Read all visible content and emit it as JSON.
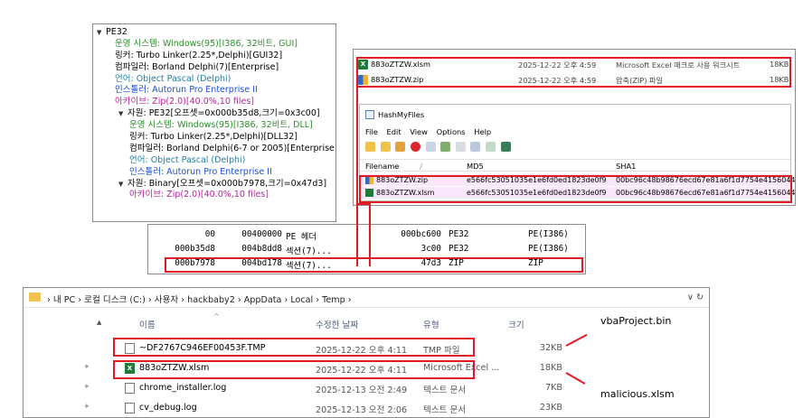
{
  "pe_tree": {
    "rows": [
      {
        "text": "PE32",
        "arrow": "▼",
        "color": "black",
        "level": "top"
      },
      {
        "text": "운영 시스템: Windows(95)[I386, 32비트, GUI]",
        "color": "green",
        "level": "indent1"
      },
      {
        "text": "링커: Turbo Linker(2.25*,Delphi)[GUI32]",
        "color": "black",
        "level": "indent1"
      },
      {
        "text": "컴파일러: Borland Delphi(7)[Enterprise]",
        "color": "black",
        "level": "indent1"
      },
      {
        "text": "언어: Object Pascal (Delphi)",
        "color": "teal",
        "level": "indent1"
      },
      {
        "text": "인스톨러: Autorun Pro Enterprise II",
        "color": "blue",
        "level": "indent1"
      },
      {
        "text": "아카이브: Zip(2.0)[40.0%,10 files]",
        "color": "mag",
        "level": "indent1"
      },
      {
        "text": "자원: PE32[오프셋=0x000b35d8,크기=0x3c00]",
        "arrow": "▼",
        "color": "black",
        "level": "sub"
      },
      {
        "text": "운영 시스템: Windows(95)[I386, 32비트, DLL]",
        "color": "green",
        "level": "indent2"
      },
      {
        "text": "링커: Turbo Linker(2.25*,Delphi)[DLL32]",
        "color": "black",
        "level": "indent2"
      },
      {
        "text": "컴파일러: Borland Delphi(6-7 or 2005)[Enterprise]",
        "color": "black",
        "level": "indent2"
      },
      {
        "text": "언어: Object Pascal (Delphi)",
        "color": "teal",
        "level": "indent2"
      },
      {
        "text": "인스톨러: Autorun Pro Enterprise II",
        "color": "blue",
        "level": "indent2"
      },
      {
        "text": "자원: Binary[오프셋=0x000b7978,크기=0x47d3]",
        "arrow": "▼",
        "color": "black",
        "level": "sub"
      },
      {
        "text": "아카이브: Zip(2.0)[40.0%,10 files]",
        "color": "mag",
        "level": "indent2"
      }
    ]
  },
  "section_table": {
    "rows": [
      {
        "offset": "00",
        "address": "00400000",
        "name": "PE 헤더",
        "size": "000bc600",
        "type": "PE32",
        "arch": "PE(I386)"
      },
      {
        "offset": "000b35d8",
        "address": "004b8dd8",
        "name": "섹션(7)...",
        "size": "3c00",
        "type": "PE32",
        "arch": "PE(I386)"
      },
      {
        "offset": "000b7978",
        "address": "004bd178",
        "name": "섹션(7)...",
        "size": "47d3",
        "type": "ZIP",
        "arch": "ZIP"
      }
    ]
  },
  "dropped_files": [
    {
      "name": "883oZTZW.xlsm",
      "date": "2025-12-22 오후 4:59",
      "type": "Microsoft Excel 매크로 사용 워크시트",
      "size": "18KB",
      "icon": "excel-icon"
    },
    {
      "name": "883oZTZW.zip",
      "date": "2025-12-22 오후 4:59",
      "type": "압축(ZIP) 파일",
      "size": "18KB",
      "icon": "zip-icon"
    }
  ],
  "hashmyfiles": {
    "title": "HashMyFiles",
    "menu": [
      "File",
      "Edit",
      "View",
      "Options",
      "Help"
    ],
    "columns": {
      "filename": "Filename",
      "md5": "MD5",
      "sha1": "SHA1",
      "sort": "/"
    },
    "rows": [
      {
        "filename": "883oZTZW.zip",
        "md5": "e566fc53051035e1e6fd0ed1823de0f9",
        "sha1": "00bc96c48b98676ecd67e81a6f1d7754e4156044"
      },
      {
        "filename": "883oZTZW.xlsm",
        "md5": "e566fc53051035e1e6fd0ed1823de0f9",
        "sha1": "00bc96c48b98676ecd67e81a6f1d7754e4156044"
      }
    ]
  },
  "explorer": {
    "address": "›  내 PC  ›  로컬 디스크 (C:)  ›  사용자  ›  hackbaby2  ›  AppData  ›  Local  ›  Temp  ›",
    "address_right": "∨  ↻",
    "columns": {
      "name": "이름",
      "date": "수정한 날짜",
      "type": "유형",
      "size": "크기"
    },
    "rows": [
      {
        "name": "~DF2767C946EF00453F.TMP",
        "date": "2025-12-22 오후 4:11",
        "type": "TMP 파일",
        "size": "32KB",
        "icon": "tmp-file-icon"
      },
      {
        "name": "883oZTZW.xlsm",
        "date": "2025-12-22 오후 4:11",
        "type": "Microsoft Excel ...",
        "size": "18KB",
        "icon": "excel-icon"
      },
      {
        "name": "chrome_installer.log",
        "date": "2025-12-13 오전 2:49",
        "type": "텍스트 문서",
        "size": "7KB",
        "icon": "text-file-icon"
      },
      {
        "name": "cv_debug.log",
        "date": "2025-12-13 오전 2:06",
        "type": "텍스트 문서",
        "size": "23KB",
        "icon": "text-file-icon"
      }
    ]
  },
  "annotations": {
    "vba": "vbaProject.bin",
    "malicious": "malicious.xlsm"
  },
  "colors": {
    "highlight": "#e01b24",
    "hash_row_bg": "#fbe7fb"
  }
}
